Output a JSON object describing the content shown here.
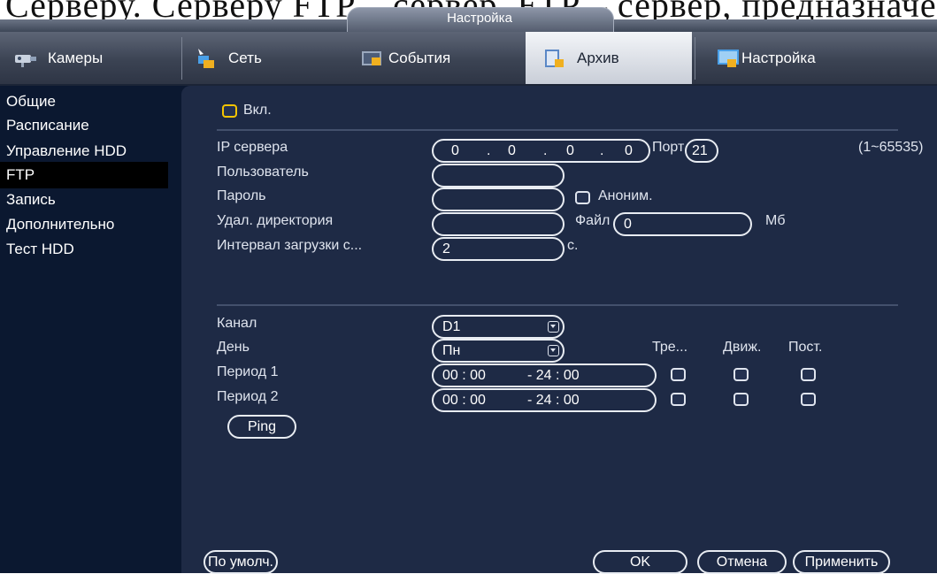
{
  "paper_strip_text": "Серверу. Серверу FTP – сервер, FTP – сервер, предназначен для хранения данных.",
  "window": {
    "title": "Настройка"
  },
  "tabs": [
    {
      "label": "Камеры",
      "icon": "camera-icon",
      "active": false
    },
    {
      "label": "Сеть",
      "icon": "network-icon",
      "active": false
    },
    {
      "label": "События",
      "icon": "events-icon",
      "active": false
    },
    {
      "label": "Архив",
      "icon": "archive-icon",
      "active": true
    },
    {
      "label": "Настройка",
      "icon": "settings-icon",
      "active": false
    }
  ],
  "sidebar": {
    "items": [
      {
        "label": "Общие"
      },
      {
        "label": "Расписание"
      },
      {
        "label": "Управление HDD"
      },
      {
        "label": "FTP",
        "active": true
      },
      {
        "label": "Запись"
      },
      {
        "label": "Дополнительно"
      },
      {
        "label": "Тест HDD"
      }
    ]
  },
  "ftp": {
    "enable_label": "Вкл.",
    "server_ip_label": "IP сервера",
    "ip_octets": [
      "0",
      "0",
      "0",
      "0"
    ],
    "ip_dot": ".",
    "port_label": "Порт",
    "port_value": "21",
    "port_range": "(1~65535)",
    "user_label": "Пользователь",
    "user_value": "",
    "password_label": "Пароль",
    "password_value": "",
    "anonymous_label": "Аноним.",
    "remote_dir_label": "Удал. директория",
    "remote_dir_value": "",
    "file_label": "Файл",
    "file_value": "0",
    "file_unit": "Мб",
    "upload_interval_label": "Интервал загрузки с...",
    "upload_interval_value": "2",
    "upload_interval_unit": "с."
  },
  "schedule": {
    "channel_label": "Канал",
    "channel_value": "D1",
    "day_label": "День",
    "day_value": "Пн",
    "col_alarm": "Тре...",
    "col_motion": "Движ.",
    "col_constant": "Пост.",
    "periods": [
      {
        "label": "Период 1",
        "start": "00 : 00",
        "end": "- 24 : 00"
      },
      {
        "label": "Период 2",
        "start": "00 : 00",
        "end": "- 24 : 00"
      }
    ],
    "ping_label": "Ping"
  },
  "footer": {
    "default_label": "По умолч.",
    "ok_label": "OK",
    "cancel_label": "Отмена",
    "apply_label": "Применить"
  },
  "colors": {
    "window_bg": "#0b1830",
    "panel_bg": "#1e2a45",
    "accent_checkbox": "#f5c400",
    "active_tab": "#e6e9ef"
  }
}
